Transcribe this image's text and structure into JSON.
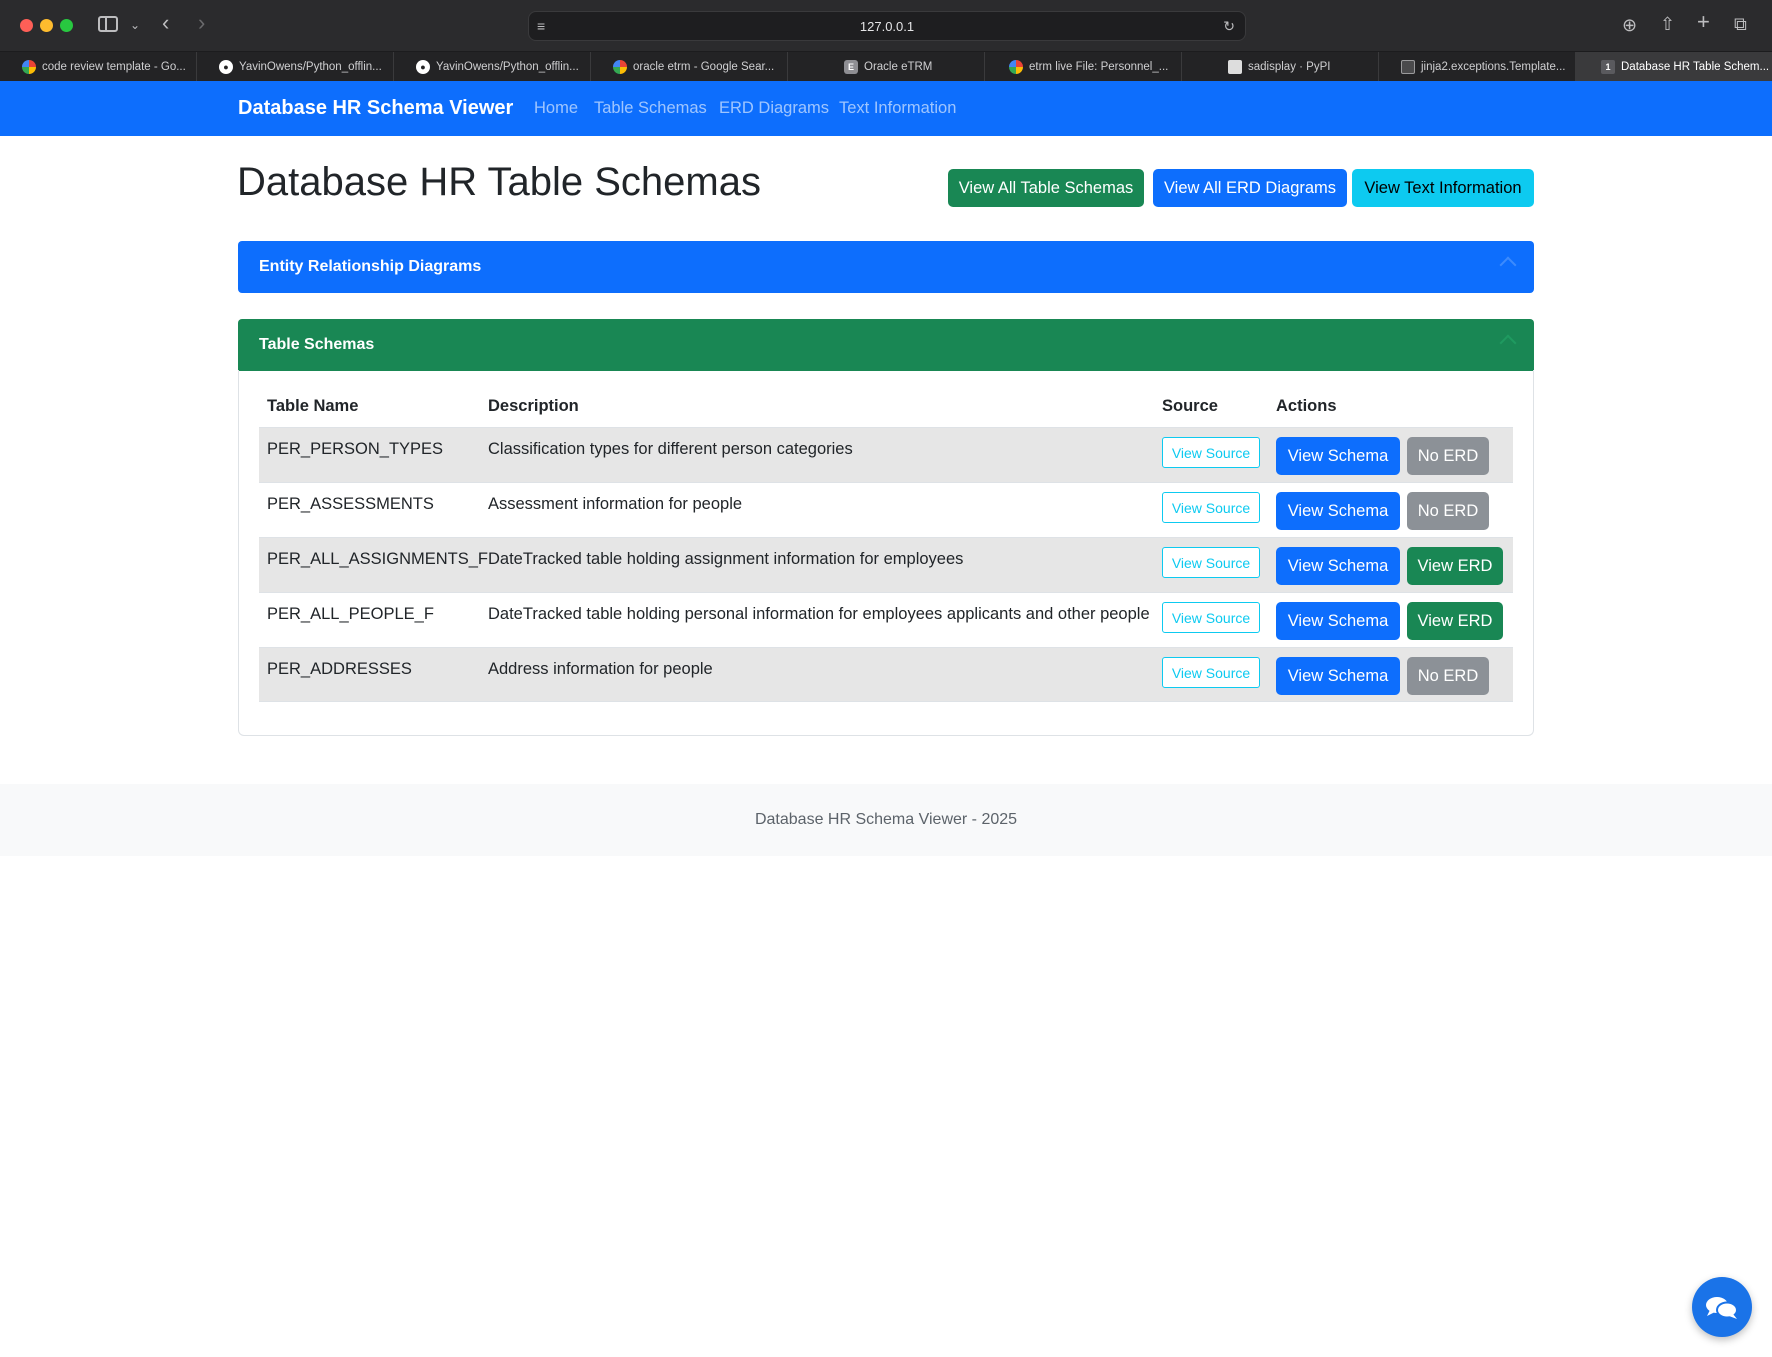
{
  "browser": {
    "address": "127.0.0.1",
    "tabs": [
      {
        "title": "code review template - Go...",
        "favicon": "google-icon"
      },
      {
        "title": "YavinOwens/Python_offlin...",
        "favicon": "github-icon"
      },
      {
        "title": "YavinOwens/Python_offlin...",
        "favicon": "github-icon"
      },
      {
        "title": "oracle etrm - Google Sear...",
        "favicon": "google-icon"
      },
      {
        "title": "Oracle eTRM",
        "favicon": "etrm-icon",
        "favicon_letter": "E"
      },
      {
        "title": "etrm live File: Personnel_...",
        "favicon": "google-icon"
      },
      {
        "title": "sadisplay · PyPI",
        "favicon": "pypi-icon"
      },
      {
        "title": "jinja2.exceptions.Template...",
        "favicon": "terminal-icon"
      },
      {
        "title": "Database HR Table Schem...",
        "favicon": "local-icon",
        "favicon_letter": "1",
        "active": true
      }
    ]
  },
  "navbar": {
    "brand": "Database HR Schema Viewer",
    "links": [
      "Home",
      "Table Schemas",
      "ERD Diagrams",
      "Text Information"
    ]
  },
  "main": {
    "title": "Database HR Table Schemas",
    "header_buttons": [
      {
        "label": "View All Table Schemas",
        "color": "#198754"
      },
      {
        "label": "View All ERD Diagrams",
        "color": "#0d6efd"
      },
      {
        "label": "View Text Information",
        "color": "#0dcaf0"
      }
    ],
    "erd_section": {
      "title": "Entity Relationship Diagrams",
      "color": "#0d6efd"
    },
    "schema_section": {
      "title": "Table Schemas",
      "color": "#198754"
    },
    "table": {
      "headers": [
        "Table Name",
        "Description",
        "Source",
        "Actions"
      ],
      "rows": [
        {
          "name": "PER_PERSON_TYPES",
          "description": "Classification types for different person categories",
          "source": "View Source",
          "schema": "View Schema",
          "erd": "No ERD",
          "has_erd": false
        },
        {
          "name": "PER_ASSESSMENTS",
          "description": "Assessment information for people",
          "source": "View Source",
          "schema": "View Schema",
          "erd": "No ERD",
          "has_erd": false
        },
        {
          "name": "PER_ALL_ASSIGNMENTS_F",
          "description": "DateTracked table holding assignment information for employees",
          "source": "View Source",
          "schema": "View Schema",
          "erd": "View ERD",
          "has_erd": true
        },
        {
          "name": "PER_ALL_PEOPLE_F",
          "description": "DateTracked table holding personal information for employees applicants and other people",
          "source": "View Source",
          "schema": "View Schema",
          "erd": "View ERD",
          "has_erd": true
        },
        {
          "name": "PER_ADDRESSES",
          "description": "Address information for people",
          "source": "View Source",
          "schema": "View Schema",
          "erd": "No ERD",
          "has_erd": false
        }
      ]
    }
  },
  "footer": {
    "text": "Database HR Schema Viewer - 2025"
  },
  "chat": {
    "icon": "chat-icon"
  }
}
